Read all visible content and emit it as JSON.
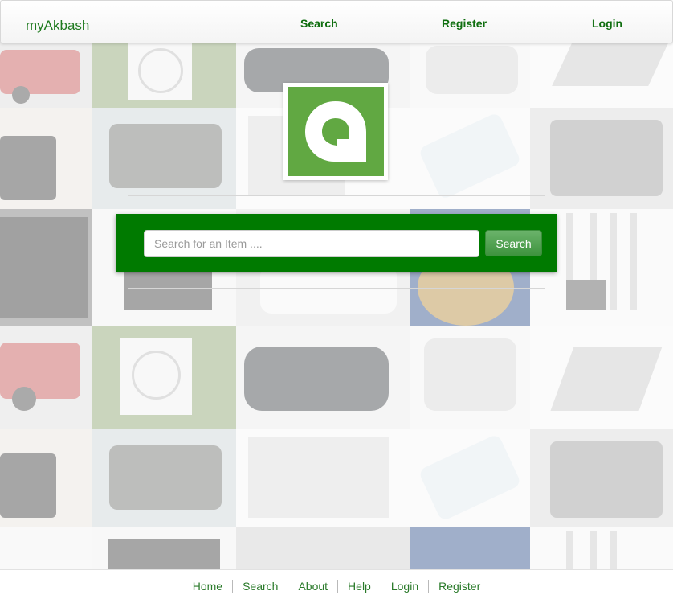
{
  "header": {
    "brand": "myAkbash",
    "nav": [
      {
        "label": "Search"
      },
      {
        "label": "Register"
      },
      {
        "label": "Login"
      }
    ]
  },
  "search": {
    "placeholder": "Search for an Item ....",
    "value": "",
    "button_label": "Search"
  },
  "footer": {
    "links": [
      {
        "label": "Home"
      },
      {
        "label": "Search"
      },
      {
        "label": "About"
      },
      {
        "label": "Help"
      },
      {
        "label": "Login"
      },
      {
        "label": "Register"
      }
    ]
  },
  "colors": {
    "brand_green": "#007a00",
    "logo_green": "#61a842",
    "link_green": "#0f6e0f"
  },
  "background_tiles": [
    "pickup-truck",
    "heat-pump",
    "sedan",
    "sedan-silver",
    "laptop",
    "tablet",
    "suv",
    "monitor",
    "smartphone",
    "engine",
    "router",
    "printer",
    "watch",
    "speakers"
  ]
}
